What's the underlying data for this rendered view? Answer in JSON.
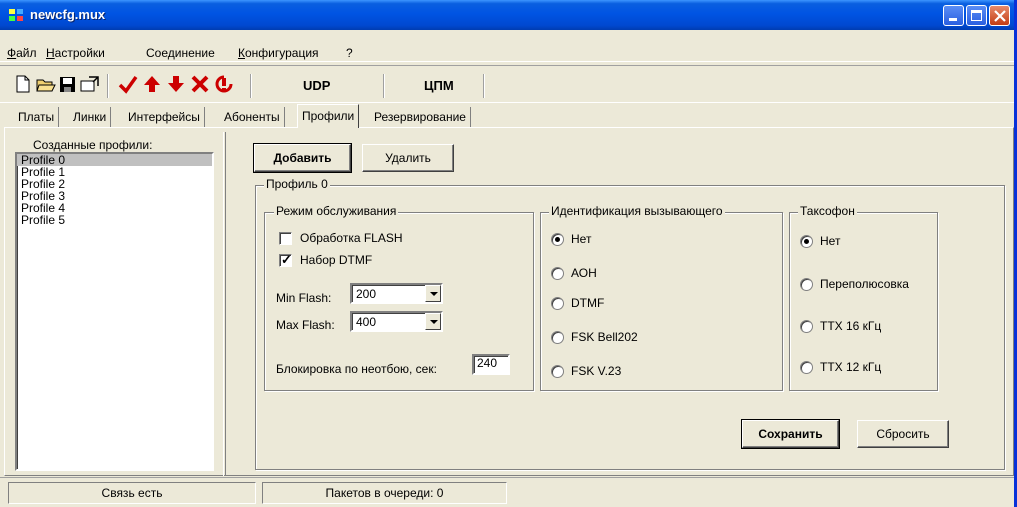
{
  "window": {
    "title": "newcfg.mux"
  },
  "menu": [
    {
      "label": "Файл",
      "accel": "Ф"
    },
    {
      "label": "Настройки",
      "accel": "Н"
    },
    {
      "label": "Соединение",
      "accel": ""
    },
    {
      "label": "Конфигурация",
      "accel": "К"
    },
    {
      "label": "?",
      "accel": ""
    }
  ],
  "toolbar": {
    "icons": [
      "new-file-icon",
      "open-folder-icon",
      "save-icon",
      "export-icon",
      "checkmark-icon",
      "arrow-up-icon",
      "arrow-down-icon",
      "delete-x-icon",
      "stop-icon"
    ],
    "udp_label": "UDP",
    "cpm_label": "ЦПМ",
    "accent_red": "#cc0000"
  },
  "tabs": [
    {
      "label": "Платы",
      "active": false
    },
    {
      "label": "Линки",
      "active": false
    },
    {
      "label": "Интерфейсы",
      "active": false
    },
    {
      "label": "Абоненты",
      "active": false
    },
    {
      "label": "Профили",
      "active": true
    },
    {
      "label": "Резервирование",
      "active": false
    }
  ],
  "profiles_panel": {
    "label": "Созданные профили:",
    "items": [
      "Profile 0",
      "Profile 1",
      "Profile 2",
      "Profile 3",
      "Profile 4",
      "Profile 5"
    ],
    "selected": "Profile 0"
  },
  "actions": {
    "add": "Добавить",
    "delete": "Удалить"
  },
  "profile": {
    "title": "Профиль 0",
    "service_mode": {
      "label": "Режим обслуживания",
      "flash_processing": {
        "label": "Обработка FLASH",
        "checked": false
      },
      "dtmf_dialing": {
        "label": "Набор DTMF",
        "checked": true
      },
      "min_flash": {
        "label": "Min Flash:",
        "value": "200"
      },
      "max_flash": {
        "label": "Max Flash:",
        "value": "400"
      },
      "block_timeout": {
        "label": "Блокировка по неотбою, сек:",
        "value": "240"
      }
    },
    "caller_id": {
      "label": "Идентификация вызывающего",
      "options": [
        "Нет",
        "АОН",
        "DTMF",
        "FSK Bell202",
        "FSK V.23"
      ],
      "selected": "Нет"
    },
    "payphone": {
      "label": "Таксофон",
      "options": [
        "Нет",
        "Переполюсовка",
        "ТТХ 16 кГц",
        "ТТХ 12 кГц"
      ],
      "selected": "Нет"
    },
    "save": "Сохранить",
    "reset": "Сбросить"
  },
  "status": {
    "connection": "Связь есть",
    "queue": "Пакетов в очереди: 0"
  }
}
